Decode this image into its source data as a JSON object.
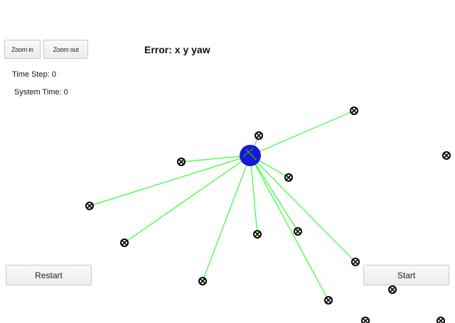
{
  "toolbar": {
    "zoom_in_label": "Zoom in",
    "zoom_out_label": "Zoom out"
  },
  "header": {
    "error_label": "Error: x y yaw"
  },
  "info": {
    "time_step": "Time Step: 0",
    "system_time": "System Time: 0"
  },
  "controls": {
    "restart_label": "Restart",
    "start_label": "Start"
  },
  "colors": {
    "robot_fill": "#1818d8",
    "robot_heading": "#2c8c2c",
    "observation_line": "#33ff33",
    "landmark_stroke": "#000000"
  }
}
